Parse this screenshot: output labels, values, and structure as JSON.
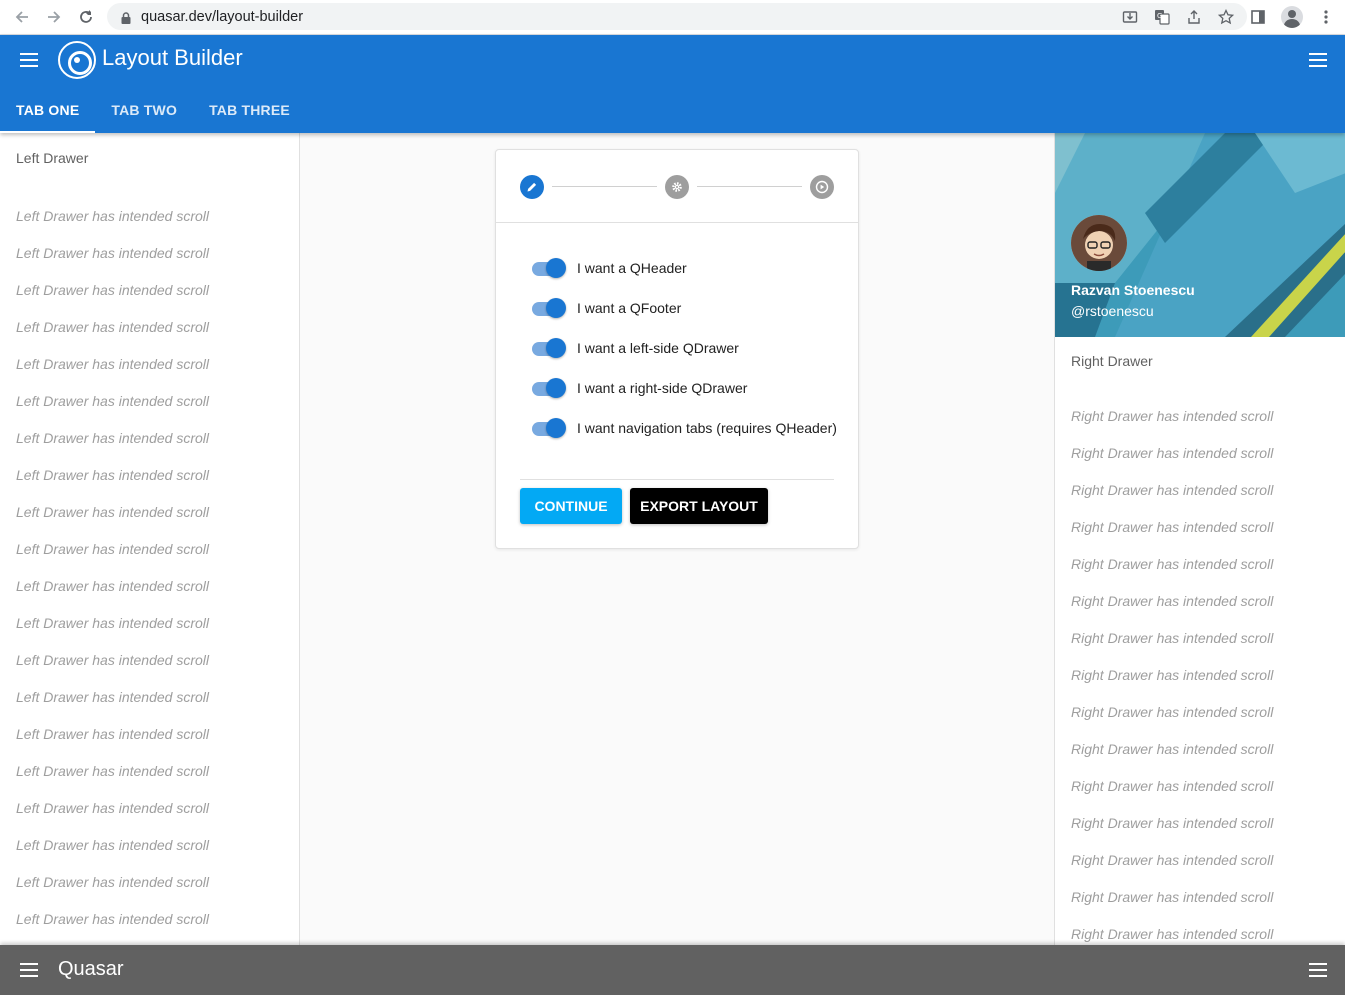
{
  "browser": {
    "url": "quasar.dev/layout-builder",
    "back_icon": "arrow-left-icon",
    "forward_icon": "arrow-right-icon",
    "reload_icon": "reload-icon"
  },
  "header": {
    "title": "Layout Builder",
    "tabs": [
      {
        "label": "TAB ONE",
        "active": true
      },
      {
        "label": "TAB TWO",
        "active": false
      },
      {
        "label": "TAB THREE",
        "active": false
      }
    ],
    "color": "#1976d2"
  },
  "left_drawer": {
    "title": "Left Drawer",
    "lines": [
      "Left Drawer has intended scroll",
      "Left Drawer has intended scroll",
      "Left Drawer has intended scroll",
      "Left Drawer has intended scroll",
      "Left Drawer has intended scroll",
      "Left Drawer has intended scroll",
      "Left Drawer has intended scroll",
      "Left Drawer has intended scroll",
      "Left Drawer has intended scroll",
      "Left Drawer has intended scroll",
      "Left Drawer has intended scroll",
      "Left Drawer has intended scroll",
      "Left Drawer has intended scroll",
      "Left Drawer has intended scroll",
      "Left Drawer has intended scroll",
      "Left Drawer has intended scroll",
      "Left Drawer has intended scroll",
      "Left Drawer has intended scroll",
      "Left Drawer has intended scroll",
      "Left Drawer has intended scroll"
    ]
  },
  "right_drawer": {
    "profile_name": "Razvan Stoenescu",
    "profile_handle": "@rstoenescu",
    "title": "Right Drawer",
    "lines": [
      "Right Drawer has intended scroll",
      "Right Drawer has intended scroll",
      "Right Drawer has intended scroll",
      "Right Drawer has intended scroll",
      "Right Drawer has intended scroll",
      "Right Drawer has intended scroll",
      "Right Drawer has intended scroll",
      "Right Drawer has intended scroll",
      "Right Drawer has intended scroll",
      "Right Drawer has intended scroll",
      "Right Drawer has intended scroll",
      "Right Drawer has intended scroll",
      "Right Drawer has intended scroll",
      "Right Drawer has intended scroll",
      "Right Drawer has intended scroll"
    ]
  },
  "stepper": {
    "steps": [
      {
        "icon": "pencil-icon",
        "active": true
      },
      {
        "icon": "gear-icon",
        "active": false
      },
      {
        "icon": "play-circle-icon",
        "active": false
      }
    ],
    "toggles": [
      {
        "label": "I want a QHeader",
        "checked": true
      },
      {
        "label": "I want a QFooter",
        "checked": true
      },
      {
        "label": "I want a left-side QDrawer",
        "checked": true
      },
      {
        "label": "I want a right-side QDrawer",
        "checked": true
      },
      {
        "label": "I want navigation tabs (requires QHeader)",
        "checked": true
      }
    ],
    "continue_label": "CONTINUE",
    "export_label": "EXPORT LAYOUT"
  },
  "footer": {
    "title": "Quasar",
    "color": "#616161"
  }
}
